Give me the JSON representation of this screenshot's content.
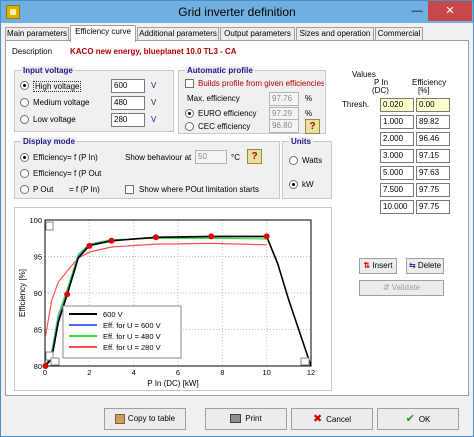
{
  "window": {
    "title": "Grid inverter definition"
  },
  "tabs": [
    {
      "label": "Main parameters"
    },
    {
      "label": "Efficiency curve"
    },
    {
      "label": "Additional parameters"
    },
    {
      "label": "Output parameters"
    },
    {
      "label": "Sizes and operation"
    },
    {
      "label": "Commercial"
    }
  ],
  "description": {
    "label": "Description",
    "value": "KACO new energy,  blueplanet 10.0 TL3 - CA"
  },
  "input_voltage": {
    "title": "Input voltage",
    "unit": "V",
    "options": [
      {
        "label": "High voltage",
        "value": "600",
        "selected": true
      },
      {
        "label": "Medium voltage",
        "value": "480",
        "selected": false
      },
      {
        "label": "Low voltage",
        "value": "280",
        "selected": false
      }
    ]
  },
  "automatic_profile": {
    "title": "Automatic profile",
    "builds_label": "Builds profile from given efficiencies",
    "max_eff_label": "Max. efficiency",
    "max_eff_value": "97.76",
    "pct": "%",
    "euro_label": "EURO efficiency",
    "euro_value": "97.29",
    "cec_label": "CEC efficiency",
    "cec_value": "96.80",
    "help": "?"
  },
  "display_mode": {
    "title": "Display mode",
    "opt1": "Efficiency= f (P In)",
    "opt2": "Efficiency= f (P Out",
    "opt3_left": "P Out",
    "opt3_right": "= f (P In)",
    "show_behaviour_label": "Show behaviour at",
    "temp_value": "50",
    "temp_unit": "°C",
    "show_limit_label": "Show where POut limitation starts",
    "help": "?"
  },
  "units": {
    "title": "Units",
    "watts": "Watts",
    "kw": "kW"
  },
  "values": {
    "title": "Values",
    "col1_header": "P In\n(DC)",
    "col1_line1": "P In",
    "col1_line2": "(DC)",
    "col2_line1": "Efficiency",
    "col2_line2": "[%]",
    "thresh_label": "Thresh.",
    "rows": [
      {
        "pin": "0.020",
        "eff": "0.00"
      },
      {
        "pin": "1.000",
        "eff": "89.82"
      },
      {
        "pin": "2.000",
        "eff": "96.46"
      },
      {
        "pin": "3.000",
        "eff": "97.15"
      },
      {
        "pin": "5.000",
        "eff": "97.63"
      },
      {
        "pin": "7.500",
        "eff": "97.75"
      },
      {
        "pin": "10.000",
        "eff": "97.75"
      }
    ],
    "insert": "Insert",
    "delete": "Delete",
    "validate": "Validate"
  },
  "chart_data": {
    "type": "line",
    "xlabel": "P In (DC) [kW]",
    "ylabel": "Efficiency [%]",
    "xlim": [
      0,
      12
    ],
    "ylim": [
      80,
      100
    ],
    "xticks": [
      "0",
      "2",
      "4",
      "6",
      "8",
      "10",
      "12"
    ],
    "yticks": [
      "80",
      "85",
      "90",
      "95",
      "100"
    ],
    "grid": true,
    "legend_position": "bottom-left",
    "series": [
      {
        "name": "600 V",
        "color": "#000000",
        "x": [
          0.02,
          0.3,
          0.6,
          1.0,
          1.5,
          2.0,
          3.0,
          5.0,
          7.5,
          10.0,
          10.5,
          11.0,
          11.5,
          12.0
        ],
        "y": [
          80.0,
          81.0,
          86.0,
          89.8,
          94.8,
          96.5,
          97.15,
          97.63,
          97.75,
          97.75,
          94.0,
          89.0,
          84.5,
          80.0
        ]
      },
      {
        "name": "Eff. for U = 600 V",
        "color": "#4a6aff",
        "x": [
          0.02,
          0.3,
          0.6,
          1.0,
          1.5,
          2.0,
          3.0,
          5.0,
          7.5,
          10.0
        ],
        "y": [
          80.0,
          81.5,
          86.5,
          90.0,
          95.0,
          96.6,
          97.2,
          97.6,
          97.7,
          97.7
        ]
      },
      {
        "name": "Eff. for U = 480 V",
        "color": "#33dd33",
        "x": [
          0.02,
          0.3,
          0.6,
          1.0,
          1.5,
          2.0,
          3.0,
          5.0,
          7.5,
          10.0
        ],
        "y": [
          80.0,
          82.0,
          87.0,
          90.5,
          95.3,
          96.7,
          97.3,
          97.5,
          97.5,
          97.4
        ]
      },
      {
        "name": "Eff. for U = 280 V",
        "color": "#ff5050",
        "x": [
          0.02,
          0.3,
          0.6,
          1.0,
          1.5,
          2.0,
          3.0,
          5.0,
          7.5,
          10.0
        ],
        "y": [
          84.0,
          89.0,
          91.5,
          93.0,
          94.8,
          95.6,
          96.3,
          96.7,
          96.8,
          96.6
        ]
      }
    ],
    "markers": {
      "color": "#e00000",
      "x": [
        0.02,
        1.0,
        2.0,
        3.0,
        5.0,
        7.5,
        10.0
      ],
      "y": [
        80.0,
        89.82,
        96.46,
        97.15,
        97.63,
        97.75,
        97.75
      ]
    }
  },
  "buttons": {
    "copy": "Copy to table",
    "print": "Print",
    "cancel": "Cancel",
    "ok": "OK"
  }
}
